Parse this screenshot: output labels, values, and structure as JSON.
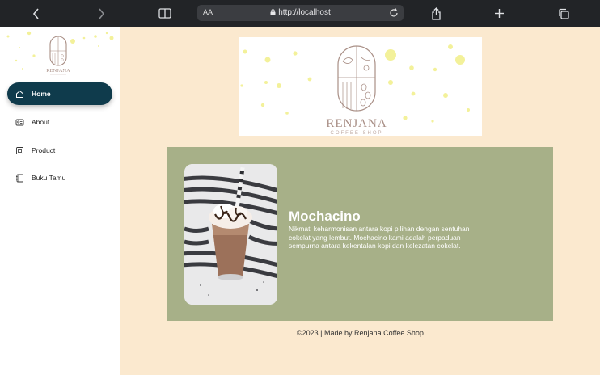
{
  "browser": {
    "aa_label": "AA",
    "address": "http://localhost",
    "icons": [
      "back-icon",
      "forward-icon",
      "book-icon",
      "lock-icon",
      "reload-icon",
      "share-icon",
      "plus-icon",
      "tabs-icon"
    ]
  },
  "sidebar": {
    "logo_text": "RENJANA",
    "items": [
      {
        "label": "Home",
        "icon": "home-icon",
        "active": true
      },
      {
        "label": "About",
        "icon": "about-icon",
        "active": false
      },
      {
        "label": "Product",
        "icon": "product-icon",
        "active": false
      },
      {
        "label": "Buku Tamu",
        "icon": "guestbook-icon",
        "active": false
      }
    ]
  },
  "banner": {
    "brand": "RENJANA",
    "tagline": "COFFEE SHOP"
  },
  "product": {
    "title": "Mochacino",
    "description": "Nikmati keharmonisan antara kopi pilihan dengan sentuhan cokelat yang lembut. Mochacino kami adalah perpaduan sempurna antara kekentalan kopi dan kelezatan cokelat."
  },
  "footer": {
    "text": "©2023 | Made by Renjana Coffee Shop"
  },
  "colors": {
    "page_bg": "#fbe9cf",
    "sidebar_active": "#0f3b4c",
    "card_bg": "#a7b088",
    "toolbar_bg": "#222427"
  }
}
